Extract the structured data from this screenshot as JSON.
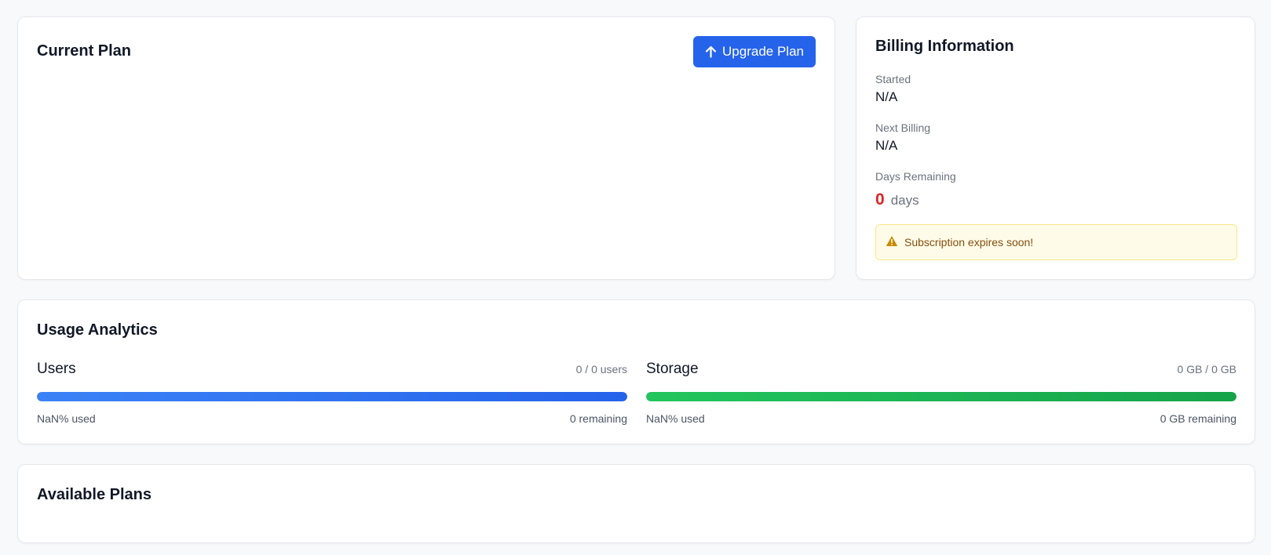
{
  "current_plan": {
    "title": "Current Plan",
    "upgrade_button_label": "Upgrade Plan",
    "upgrade_icon": "arrow-up-icon"
  },
  "billing": {
    "title": "Billing Information",
    "started_label": "Started",
    "started_value": "N/A",
    "next_billing_label": "Next Billing",
    "next_billing_value": "N/A",
    "days_remaining_label": "Days Remaining",
    "days_remaining_value": "0",
    "days_unit": "days",
    "alert_icon": "warning-triangle-icon",
    "alert_text": "Subscription expires soon!"
  },
  "usage": {
    "title": "Usage Analytics",
    "users": {
      "name": "Users",
      "count": "0 / 0 users",
      "used_text": "NaN% used",
      "remaining_text": "0 remaining",
      "bar_fill_fraction": 1.0
    },
    "storage": {
      "name": "Storage",
      "count": "0 GB / 0 GB",
      "used_text": "NaN% used",
      "remaining_text": "0 GB remaining",
      "bar_fill_fraction": 1.0
    }
  },
  "plans": {
    "title": "Available Plans"
  },
  "colors": {
    "accent": "#2563eb",
    "users_bar": "#2563eb",
    "storage_bar": "#16a34a",
    "danger": "#dc2626",
    "warning_bg": "#fefce8",
    "warning_text": "#854d0e"
  }
}
